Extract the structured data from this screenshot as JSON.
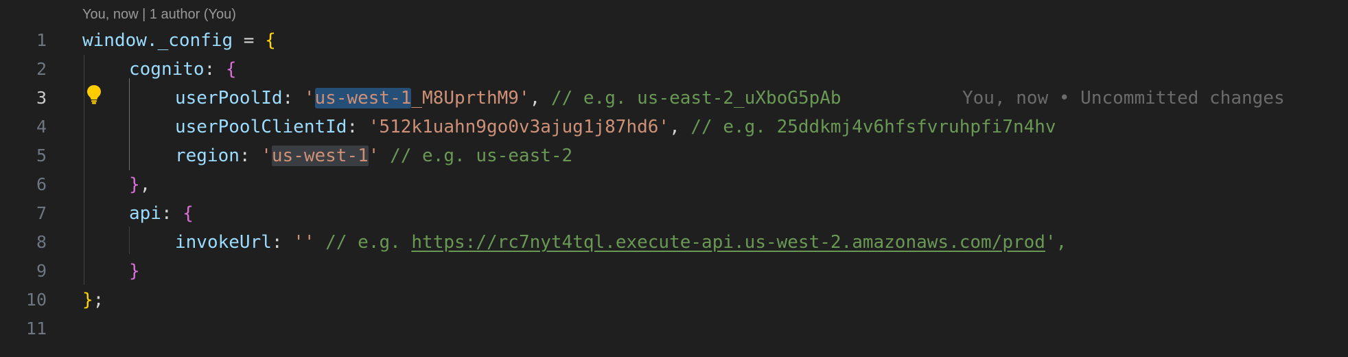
{
  "editor": {
    "codelens": "You, now | 1 author (You)",
    "blame": "You, now • Uncommitted changes",
    "lines": [
      {
        "number": "1"
      },
      {
        "number": "2"
      },
      {
        "number": "3"
      },
      {
        "number": "4"
      },
      {
        "number": "5"
      },
      {
        "number": "6"
      },
      {
        "number": "7"
      },
      {
        "number": "8"
      },
      {
        "number": "9"
      },
      {
        "number": "10"
      },
      {
        "number": "11"
      }
    ],
    "active_line": 3,
    "code": {
      "l1": {
        "obj": "window._config",
        "eq": " = ",
        "brace": "{"
      },
      "l2": {
        "key": "cognito",
        "colon": ": ",
        "brace": "{"
      },
      "l3": {
        "key": "userPoolId",
        "colon": ": ",
        "q1": "'",
        "sel": "us-west-1",
        "rest": "_M8UprthM9",
        "q2": "'",
        "comma": ", ",
        "comment": "// e.g. us-east-2_uXboG5pAb"
      },
      "l4": {
        "key": "userPoolClientId",
        "colon": ": ",
        "value": "'512k1uahn9go0v3ajug1j87hd6'",
        "comma": ", ",
        "comment": "// e.g. 25ddkmj4v6hfsfvruhpfi7n4hv"
      },
      "l5": {
        "key": "region",
        "colon": ": ",
        "q1": "'",
        "hl": "us-west-1",
        "q2": "'",
        "sp": " ",
        "comment": "// e.g. us-east-2"
      },
      "l6": {
        "brace": "}",
        "comma": ","
      },
      "l7": {
        "key": "api",
        "colon": ": ",
        "brace": "{"
      },
      "l8": {
        "key": "invokeUrl",
        "colon": ": ",
        "value": "''",
        "sp": " ",
        "comment": "// e.g. ",
        "link": "https://rc7nyt4tql.execute-api.us-west-2.amazonaws.com/prod",
        "tail": "',"
      },
      "l9": {
        "brace": "}"
      },
      "l10": {
        "brace": "}",
        "semi": ";"
      }
    }
  },
  "colors": {
    "background": "#1f1f1f",
    "variable": "#9cdcfe",
    "string": "#ce9178",
    "comment": "#6a9955",
    "bracket_level1": "#ffd700",
    "bracket_level2": "#da70d6",
    "selection": "#264f78"
  }
}
